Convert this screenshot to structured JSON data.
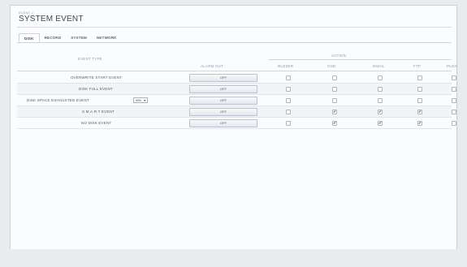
{
  "breadcrumb": "EVENT >",
  "page_title": "SYSTEM EVENT",
  "tabs": [
    {
      "label": "DISK",
      "active": true
    },
    {
      "label": "RECORD",
      "active": false
    },
    {
      "label": "SYSTEM",
      "active": false
    },
    {
      "label": "NETWORK",
      "active": false
    }
  ],
  "headers": {
    "event_type": "EVENT TYPE",
    "alarm_out": "ALARM OUT",
    "action": "ACTION",
    "buzzer": "BUZZER",
    "osd": "OSD",
    "email": "EMAIL",
    "ftp": "FTP",
    "push": "PUSH"
  },
  "rows": [
    {
      "label": "OVERWRITE START EVENT",
      "alarm": "OFF",
      "buzzer": false,
      "osd": false,
      "email": false,
      "ftp": false,
      "push": false
    },
    {
      "label": "DISK FULL EVENT",
      "alarm": "OFF",
      "buzzer": false,
      "osd": false,
      "email": false,
      "ftp": false,
      "push": false
    },
    {
      "label": "DISK SPACE EXHAUSTED EVENT",
      "threshold": "90%",
      "alarm": "OFF",
      "buzzer": false,
      "osd": false,
      "email": false,
      "ftp": false,
      "push": false
    },
    {
      "label": "S.M.A.R.T EVENT",
      "alarm": "OFF",
      "buzzer": false,
      "osd": true,
      "email": true,
      "ftp": true,
      "push": false
    },
    {
      "label": "NO DISK EVENT",
      "alarm": "OFF",
      "buzzer": false,
      "osd": true,
      "email": true,
      "ftp": true,
      "push": false
    }
  ],
  "icons": {
    "select_arrow": "dropdown-arrow-icon",
    "check": "checkmark-icon"
  }
}
